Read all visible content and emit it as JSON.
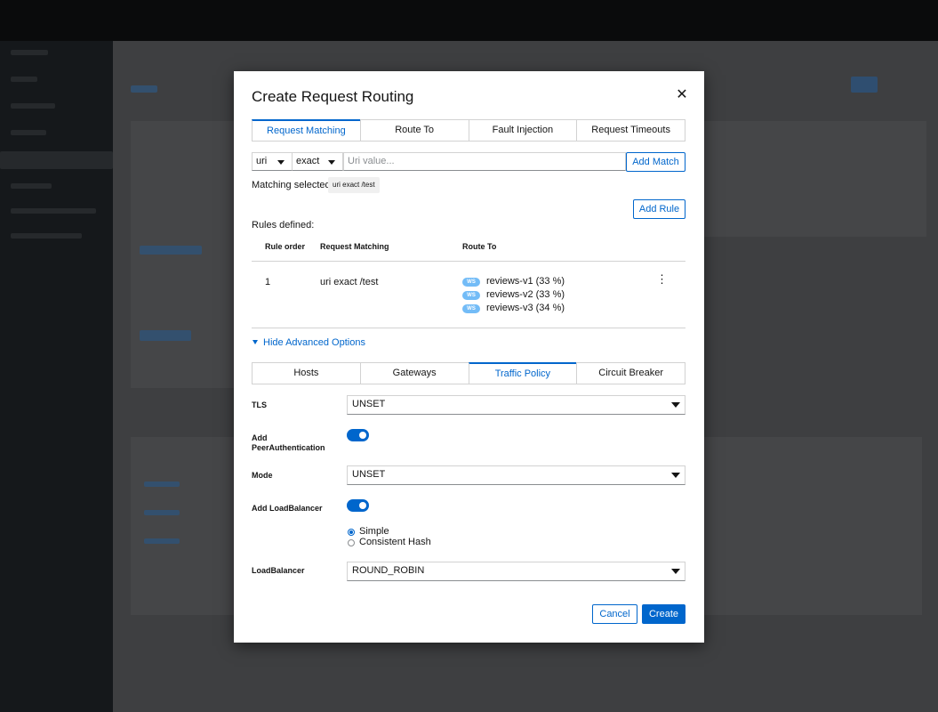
{
  "modal": {
    "title": "Create Request Routing",
    "close_icon": "close-icon"
  },
  "top_tabs": [
    {
      "label": "Request Matching",
      "active": true
    },
    {
      "label": "Route To",
      "active": false
    },
    {
      "label": "Fault Injection",
      "active": false
    },
    {
      "label": "Request Timeouts",
      "active": false
    }
  ],
  "match": {
    "field_select": "uri",
    "operator_select": "exact",
    "value_placeholder": "Uri value...",
    "add_match_label": "Add Match",
    "selected_label": "Matching selected:",
    "selected_chip": "uri exact /test"
  },
  "rules": {
    "add_rule_label": "Add Rule",
    "defined_label": "Rules defined:",
    "headers": [
      "Rule order",
      "Request Matching",
      "Route To"
    ],
    "rows": [
      {
        "order": "1",
        "matching": "uri exact /test",
        "routes": [
          {
            "badge": "WS",
            "text": "reviews-v1 (33 %)"
          },
          {
            "badge": "WS",
            "text": "reviews-v2 (33 %)"
          },
          {
            "badge": "WS",
            "text": "reviews-v3 (34 %)"
          }
        ]
      }
    ]
  },
  "advanced": {
    "toggle_label": "Hide Advanced Options"
  },
  "advanced_tabs": [
    {
      "label": "Hosts",
      "active": false
    },
    {
      "label": "Gateways",
      "active": false
    },
    {
      "label": "Traffic Policy",
      "active": true
    },
    {
      "label": "Circuit Breaker",
      "active": false
    }
  ],
  "traffic_policy": {
    "tls_label": "TLS",
    "tls_value": "UNSET",
    "peer_auth_label_1": "Add",
    "peer_auth_label_2": "PeerAuthentication",
    "peer_auth_enabled": true,
    "mode_label": "Mode",
    "mode_value": "UNSET",
    "lb_add_label": "Add LoadBalancer",
    "lb_enabled": true,
    "lb_options": [
      {
        "label": "Simple",
        "checked": true
      },
      {
        "label": "Consistent Hash",
        "checked": false
      }
    ],
    "lb_label": "LoadBalancer",
    "lb_value": "ROUND_ROBIN"
  },
  "footer": {
    "cancel_label": "Cancel",
    "create_label": "Create"
  },
  "colors": {
    "accent": "#0066cc",
    "badge": "#73bcf7"
  }
}
